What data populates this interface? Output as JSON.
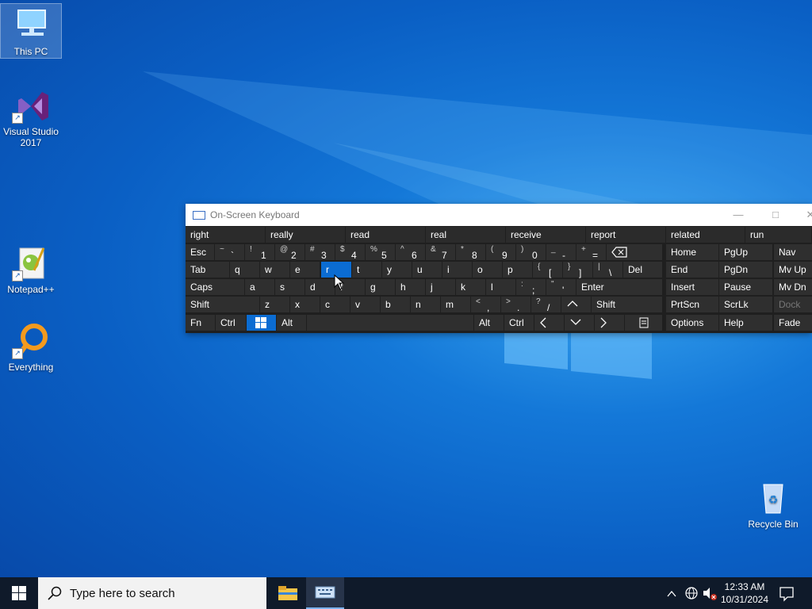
{
  "desktop": {
    "icons": [
      {
        "label": "This PC"
      },
      {
        "label": "Visual Studio 2017"
      },
      {
        "label": "Notepad++"
      },
      {
        "label": "Everything"
      },
      {
        "label": "Recycle Bin"
      }
    ]
  },
  "osk": {
    "title": "On-Screen Keyboard",
    "predictions": [
      "right",
      "really",
      "read",
      "real",
      "receive",
      "report",
      "related",
      "run"
    ],
    "row1": {
      "esc": "Esc",
      "keys": [
        {
          "shift": "~",
          "main": "`"
        },
        {
          "shift": "!",
          "main": "1"
        },
        {
          "shift": "@",
          "main": "2"
        },
        {
          "shift": "#",
          "main": "3"
        },
        {
          "shift": "$",
          "main": "4"
        },
        {
          "shift": "%",
          "main": "5"
        },
        {
          "shift": "^",
          "main": "6"
        },
        {
          "shift": "&",
          "main": "7"
        },
        {
          "shift": "*",
          "main": "8"
        },
        {
          "shift": "(",
          "main": "9"
        },
        {
          "shift": ")",
          "main": "0"
        },
        {
          "shift": "_",
          "main": "-"
        },
        {
          "shift": "+",
          "main": "="
        }
      ],
      "backspace_icon": "backspace-icon",
      "nav": [
        "Home",
        "PgUp",
        "Nav"
      ]
    },
    "row2": {
      "tab": "Tab",
      "letters": [
        "q",
        "w",
        "e",
        "r",
        "t",
        "y",
        "u",
        "i",
        "o",
        "p"
      ],
      "brackets": [
        {
          "shift": "{",
          "main": "["
        },
        {
          "shift": "}",
          "main": "]"
        },
        {
          "shift": "|",
          "main": "\\"
        }
      ],
      "del": "Del",
      "nav": [
        "End",
        "PgDn",
        "Mv Up"
      ]
    },
    "row3": {
      "caps": "Caps",
      "letters": [
        "a",
        "s",
        "d",
        "f",
        "g",
        "h",
        "j",
        "k",
        "l"
      ],
      "punct": [
        {
          "shift": ":",
          "main": ";"
        },
        {
          "shift": "\"",
          "main": "'"
        }
      ],
      "enter": "Enter",
      "nav": [
        "Insert",
        "Pause",
        "Mv Dn"
      ]
    },
    "row4": {
      "shift": "Shift",
      "letters": [
        "z",
        "x",
        "c",
        "v",
        "b",
        "n",
        "m"
      ],
      "punct": [
        {
          "shift": "<",
          "main": ","
        },
        {
          "shift": ">",
          "main": "."
        },
        {
          "shift": "?",
          "main": "/"
        }
      ],
      "up_icon": "arrow-up-icon",
      "shift_right": "Shift",
      "nav": [
        "PrtScn",
        "ScrLk",
        "Dock"
      ]
    },
    "row5": {
      "fn": "Fn",
      "ctrl": "Ctrl",
      "win_icon": "windows-icon",
      "alt": "Alt",
      "alt_right": "Alt",
      "ctrl_right": "Ctrl",
      "nav": [
        "Options",
        "Help",
        "Fade"
      ]
    },
    "active_key": "r"
  },
  "taskbar": {
    "search_placeholder": "Type here to search",
    "time": "12:33 AM",
    "date": "10/31/2024"
  }
}
